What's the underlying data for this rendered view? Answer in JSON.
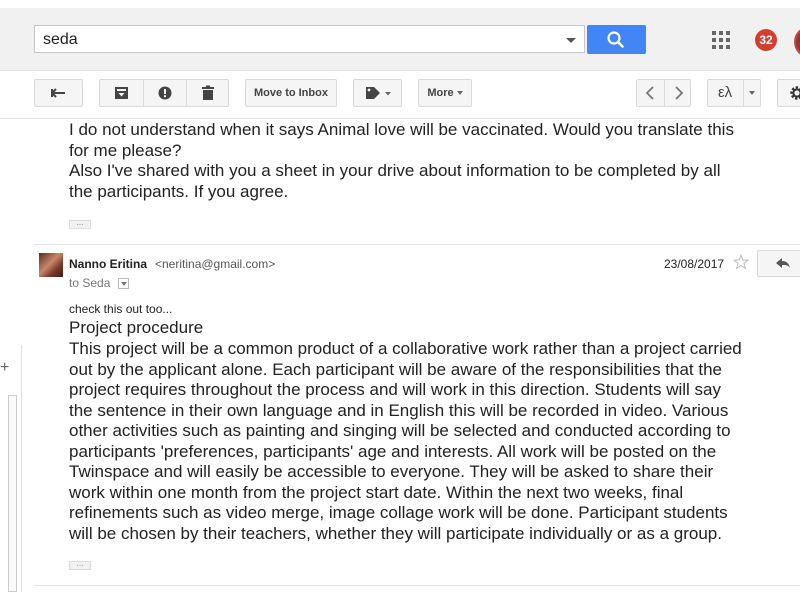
{
  "search": {
    "query": "seda"
  },
  "header": {
    "notification_count": "32"
  },
  "toolbar": {
    "move_to_inbox_label": "Move to Inbox",
    "more_label": "More",
    "language_label": "ελ"
  },
  "previous_message": {
    "lines": [
      "I do not understand when it says  Animal love will be vaccinated. Would you translate this",
      "for me please?",
      "Also I've shared with you a sheet in your drive about information to be completed by all",
      "the participants. If you agree."
    ]
  },
  "message": {
    "sender_name": "Nanno Eritina",
    "sender_email": "<neritina@gmail.com>",
    "to": "to Seda",
    "date": "23/08/2017",
    "note": "check this out too...",
    "heading": "Project procedure",
    "body_lines": [
      "This project will be a common product of a collaborative work rather than a project carried",
      "out by the applicant alone. Each participant will be aware of the responsibilities that the",
      "project requires throughout the process and will work in this direction. Students will say",
      "the sentence in their own language and in English this will be recorded in video. Various",
      "other activities such as painting and singing will be selected and conducted according to",
      "participants 'preferences, participants' age and interests. All work will be posted on the",
      "Twinspace and will easily be accessible to everyone. They will be asked to share their",
      "work within one month from the project start date. Within the next two weeks, final",
      "refinements such as video merge, image collage work will be done. Participant students",
      "will be chosen by their teachers, whether they will participate individually or as a group."
    ]
  },
  "left_panel": {
    "plus_label": "+"
  },
  "colors": {
    "accent": "#4285f4",
    "badge": "#d23f31"
  }
}
